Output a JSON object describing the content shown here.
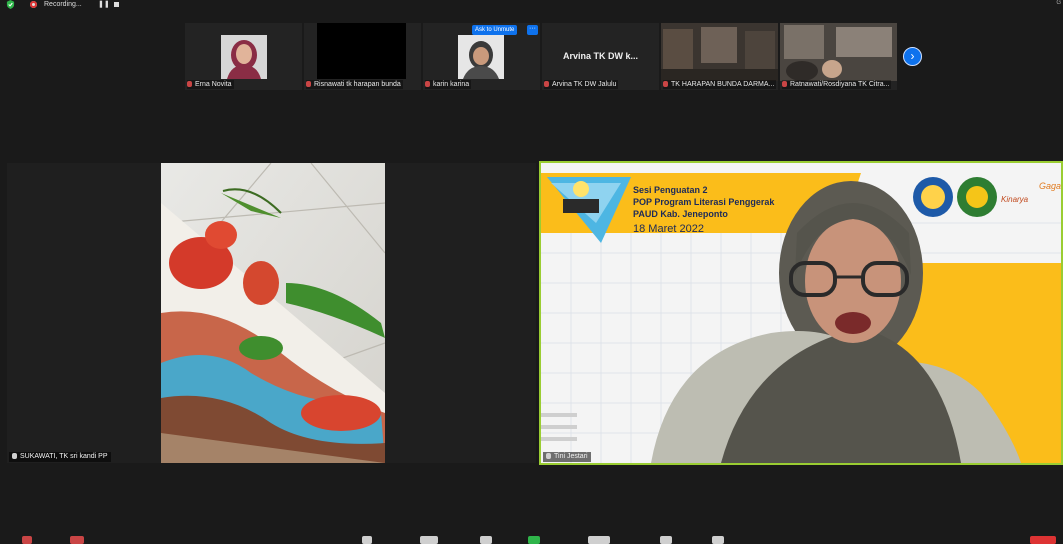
{
  "topbar": {
    "recording_label": "Recording...",
    "pause_icon": "pause-icon",
    "stop_icon": "stop-icon",
    "corner_text": "G"
  },
  "strip": {
    "tiles": [
      {
        "name": "Erna Novita"
      },
      {
        "name": "Risnawati tk harapan bunda"
      },
      {
        "name": "karin karina",
        "ask_to_unmute": "Ask to Unmute",
        "more": "···"
      },
      {
        "name": "Arvina TK DW Jalulu",
        "display_name": "Arvina TK DW k..."
      },
      {
        "name": "TK HARAPAN BUNDA DARMA..."
      },
      {
        "name": "Ratnawati/Rosdiyana TK Citra..."
      }
    ],
    "next_label": "›"
  },
  "main": {
    "left_name": "SUKAWATI, TK sri kandi PP",
    "right_name": "Tini Jestari"
  },
  "slide": {
    "title1": "Sesi Penguatan 2",
    "title2": "POP Program Literasi Penggerak",
    "title3": "PAUD Kab. Jeneponto",
    "date": "18 Maret 2022",
    "logo_text": "Kinarya",
    "logo_text2": "Gagas"
  },
  "colors": {
    "accent_blue": "#0e72ed",
    "slide_yellow": "#fbbd1a",
    "active_speaker_border": "#9acd32"
  }
}
